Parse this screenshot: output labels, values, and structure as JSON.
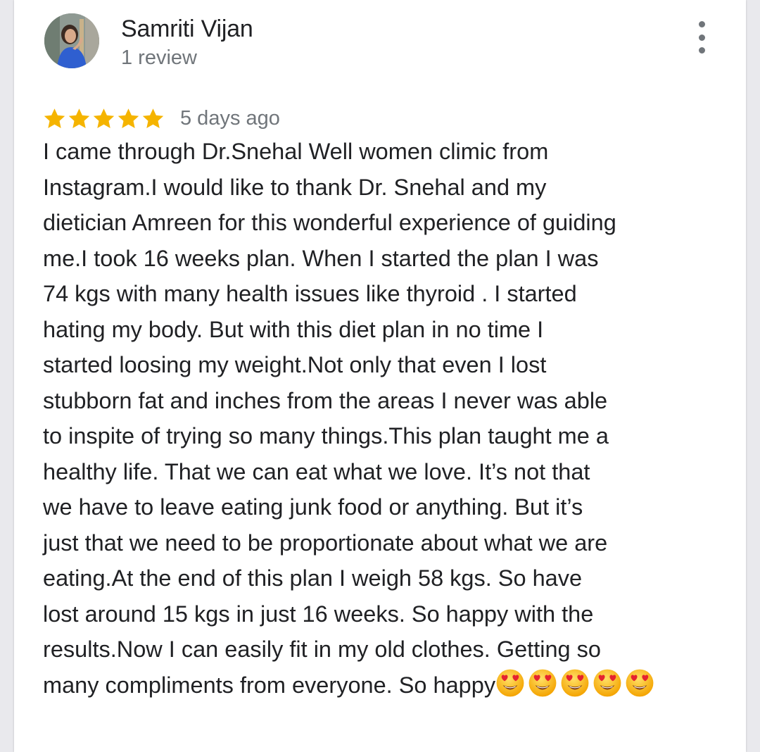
{
  "review": {
    "reviewer_name": "Samriti Vijan",
    "review_count": "1 review",
    "rating": 5,
    "max_rating": 5,
    "time_ago": "5 days ago",
    "text": "I came through Dr.Snehal Well women climic from\nInstagram.I would like to thank Dr. Snehal and my\ndietician Amreen for this wonderful experience of guiding\nme.I took 16 weeks plan. When I started the plan I was\n74 kgs with many health issues like thyroid . I started\nhating my body. But with this diet plan in no time I\nstarted loosing my weight.Not only that even I lost\nstubborn fat and inches from the areas I never was able\nto inspite of trying so many things.This plan taught me a\nhealthy life. That we can eat what we love. It’s not that\nwe have to leave eating junk food or anything. But it’s\njust that we need to be proportionate about what we are\neating.At the end of this plan I weigh 58 kgs. So have\nlost around 15 kgs in just 16 weeks. So happy with the\nresults.Now I can easily fit in my old clothes. Getting so\nmany compliments from everyone. So happy",
    "trailing_emoji": [
      "heart-eyes-emoji",
      "heart-eyes-emoji",
      "heart-eyes-emoji",
      "heart-eyes-emoji",
      "heart-eyes-emoji"
    ]
  },
  "icons": {
    "star": "star-icon",
    "more": "more-vertical-icon"
  },
  "colors": {
    "star": "#f5b400",
    "name_text": "#202124",
    "secondary_text": "#70757a",
    "card_background": "#ffffff"
  }
}
